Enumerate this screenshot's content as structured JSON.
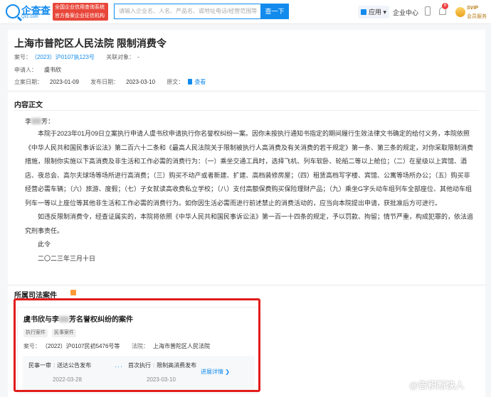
{
  "header": {
    "logo_text": "企查查",
    "logo_sub": "Qcc.com",
    "tagline": "全国企业信用查询系统 官方备案企业征信机构",
    "search_placeholder": "请输入企业名、人名、产品名、或地址电话/经营范围等",
    "search_button": "查一下",
    "apps_label": "应用",
    "enterprise_label": "企业中心",
    "notification_count": "6",
    "vip_title": "SVIP",
    "vip_sub": "会员服务"
  },
  "order": {
    "title": "上海市普陀区人民法院 限制消费令",
    "case_no_label": "案号：",
    "case_no": "（2023）沪0107执123号",
    "related_label": "关联对象：",
    "related_value": "-",
    "applicant_label": "申请人：",
    "applicant": "虞书欣",
    "filing_date_label": "立案日期：",
    "filing_date": "2023-01-09",
    "publish_date_label": "发布日期：",
    "publish_date": "2023-03-10",
    "original_label": "原文：",
    "original_link": "查看"
  },
  "content": {
    "section_title": "内容正文",
    "salutation_prefix": "李",
    "salutation_suffix": "芳：",
    "paragraph1": "本院于2023年01月09日立案执行申请人虞书欣申请执行你名誉权纠纷一案。因你未按执行通知书指定的期间履行生效法律文书确定的给付义务，本院依照《中华人民共和国民事诉讼法》第二百六十二条和《最高人民法院关于限制被执行人高消费及有关消费的若干规定》第一条、第三条的规定，对你采取限制消费措施，限制你实施以下高消费及非生活和工作必需的消费行为：（一）乘坐交通工具时，选择飞机、列车软卧、轮船二等以上舱位；（二）在星级以上宾馆、酒店、夜总会、高尔夫球场等场所进行高消费；（三）购买不动产或者新建、扩建、高档装修房屋；（四）租赁高档写字楼、宾馆、公寓等场所办公；（五）购买非经营必需车辆；（六）旅游、度假；（七）子女就读高收费私立学校；（八）支付高额保费购买保险理财产品；（九）乘坐G字头动车组列车全部座位、其他动车组列车一等以上座位等其他非生活和工作必需的消费行为。如你因生活必需而进行前述禁止的消费活动的，应当向本院提出申请，获批准后方可进行。",
    "paragraph2": "如违反限制消费令，经查证属实的，本院将依照《中华人民共和国民事诉讼法》第一百一十四条的规定，予以罚款、拘留；情节严重，构成犯罪的，依法追究刑事责任。",
    "closing": "此令",
    "date": "二〇二三年三月十日"
  },
  "cases": {
    "section_title": "所属司法案件",
    "card": {
      "title_prefix": "虞书欣与李",
      "title_suffix": "芳名誉权纠纷的案件",
      "tags": [
        "执行案件",
        "民事案件"
      ],
      "case_no_label": "案号：",
      "case_no": "（2022）沪0107民初5476号等",
      "court_label": "法院：",
      "court": "上海市普陀区人民法院",
      "steps": [
        {
          "stage": "民事一审",
          "event": "送达公告发布",
          "date": "2022-03-28"
        },
        {
          "stage": "首次执行",
          "event": "限制高消费发布",
          "date": "2023-03-10"
        }
      ],
      "dots": "···",
      "more_label": "进展详情 ❯"
    }
  },
  "watermark": "@告积断快人"
}
